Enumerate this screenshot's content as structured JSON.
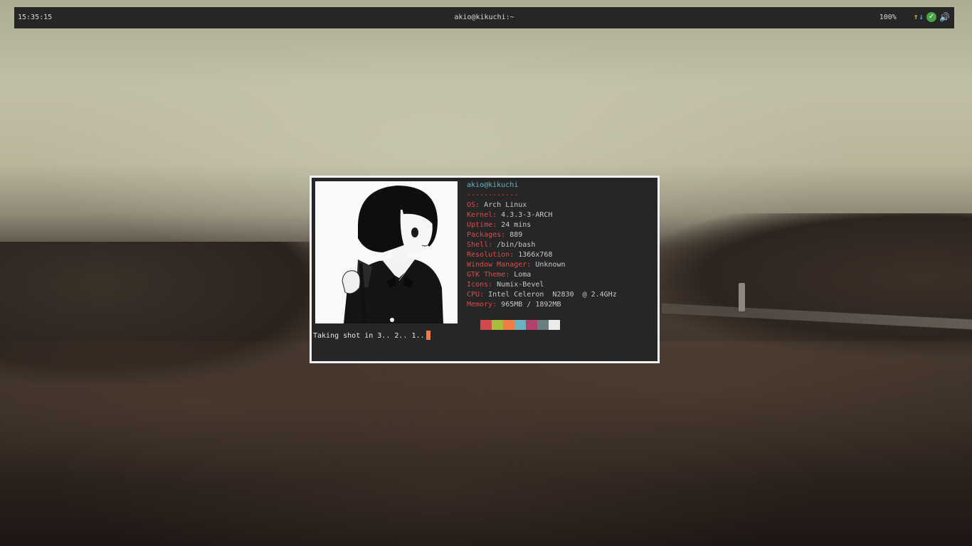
{
  "topbar": {
    "clock": "15:35:15",
    "window_title": "akio@kikuchi:~",
    "battery": "100%",
    "icons": [
      "network-activity-icon",
      "check-icon",
      "volume-icon"
    ]
  },
  "terminal": {
    "user_host": "akio@kikuchi",
    "separator": "------------",
    "fields": [
      {
        "key": "OS",
        "value": "Arch Linux"
      },
      {
        "key": "Kernel",
        "value": "4.3.3-3-ARCH"
      },
      {
        "key": "Uptime",
        "value": "24 mins"
      },
      {
        "key": "Packages",
        "value": "889"
      },
      {
        "key": "Shell",
        "value": "/bin/bash"
      },
      {
        "key": "Resolution",
        "value": "1366x768"
      },
      {
        "key": "Window Manager",
        "value": "Unknown"
      },
      {
        "key": "GTK Theme",
        "value": "Loma"
      },
      {
        "key": "Icons",
        "value": "Numix-Bevel"
      },
      {
        "key": "CPU",
        "value": "Intel Celeron  N2830  @ 2.4GHz"
      },
      {
        "key": "Memory",
        "value": "965MB / 1892MB"
      }
    ],
    "palette": [
      "#d24a4c",
      "#a9bc3c",
      "#ef7d44",
      "#6db0c0",
      "#b2416e",
      "#6c7f80",
      "#ececec"
    ],
    "prompt": "Taking shot in 3.. 2.. 1.."
  },
  "colors": {
    "bar_bg": "#262626",
    "key_red": "#e04848",
    "title_cyan": "#58b7c9",
    "cursor_orange": "#ef7c43"
  }
}
